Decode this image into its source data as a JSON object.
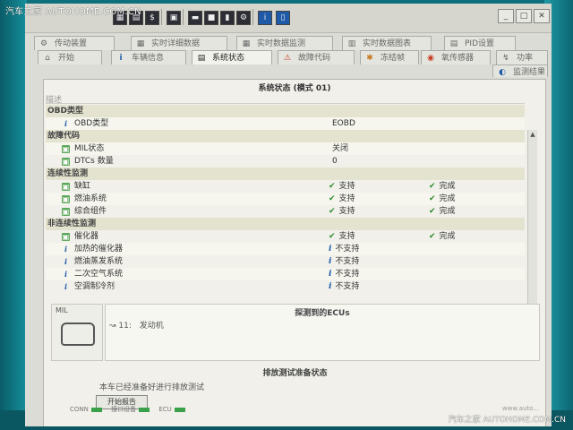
{
  "watermark": {
    "top": "汽车之家 AUTOHOME.COM.CN",
    "bottom": "汽车之家 AUTOHOME.COM.CN"
  },
  "tabs": {
    "row1": [
      {
        "label": "传动装置",
        "icon": "gear-icon"
      },
      {
        "label": "实时详细数据",
        "icon": "grid-icon"
      },
      {
        "label": "实时数据监测",
        "icon": "grid-icon"
      },
      {
        "label": "实时数据图表",
        "icon": "chart-icon"
      },
      {
        "label": "PID设置",
        "icon": "settings-icon"
      }
    ],
    "row2": [
      {
        "label": "开始",
        "icon": "home-icon"
      },
      {
        "label": "车辆信息",
        "icon": "info-icon"
      },
      {
        "label": "系统状态",
        "icon": "status-icon",
        "active": true
      },
      {
        "label": "故障代码",
        "icon": "warning-icon"
      },
      {
        "label": "冻结帧",
        "icon": "snowflake-icon"
      },
      {
        "label": "氧传感器",
        "icon": "sensor-icon"
      },
      {
        "label": "功率",
        "icon": "power-icon"
      }
    ],
    "extra": "监测结果"
  },
  "panel": {
    "title": "系统状态 (模式 01)",
    "header_col": "描述"
  },
  "rows": [
    {
      "type": "section",
      "label": "OBD类型"
    },
    {
      "type": "item",
      "icon": "info",
      "label": "OBD类型",
      "value": "EOBD"
    },
    {
      "type": "section",
      "label": "故障代码"
    },
    {
      "type": "item",
      "icon": "green",
      "label": "MIL状态",
      "value": "关闭"
    },
    {
      "type": "item",
      "icon": "green",
      "label": "DTCs 数量",
      "value": "0"
    },
    {
      "type": "section",
      "label": "连续性监测"
    },
    {
      "type": "item",
      "icon": "green",
      "label": "缺缸",
      "support": "支持",
      "status": "完成"
    },
    {
      "type": "item",
      "icon": "green",
      "label": "燃油系统",
      "support": "支持",
      "status": "完成"
    },
    {
      "type": "item",
      "icon": "green",
      "label": "综合组件",
      "support": "支持",
      "status": "完成"
    },
    {
      "type": "section",
      "label": "非连续性监测"
    },
    {
      "type": "item",
      "icon": "green",
      "label": "催化器",
      "support": "支持",
      "status": "完成"
    },
    {
      "type": "item",
      "icon": "info",
      "label": "加热的催化器",
      "support": "不支持"
    },
    {
      "type": "item",
      "icon": "info",
      "label": "燃油蒸发系统",
      "support": "不支持"
    },
    {
      "type": "item",
      "icon": "info",
      "label": "二次空气系统",
      "support": "不支持"
    },
    {
      "type": "item",
      "icon": "info",
      "label": "空调制冷剂",
      "support": "不支持"
    }
  ],
  "mil": {
    "label": "MIL"
  },
  "ecu": {
    "title": "探测到的ECUs",
    "item": "发动机",
    "prefix": "11:"
  },
  "emission": {
    "title": "排放测试准备状态",
    "text": "本车已经准备好进行排放测试",
    "button": "开始报告"
  },
  "status_bar": {
    "items": [
      "CONN",
      "接口设备",
      "ECU"
    ],
    "url": "www.auto..."
  }
}
